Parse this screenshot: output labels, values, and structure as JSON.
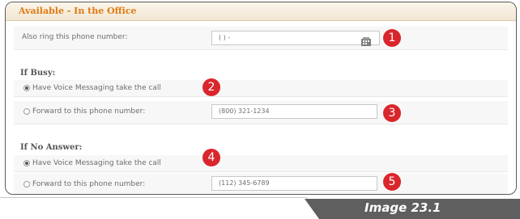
{
  "section": {
    "title": "Available - In the Office"
  },
  "also_ring": {
    "label": "Also ring this phone number:",
    "value": "( )  -"
  },
  "if_busy": {
    "heading": "If Busy:",
    "voice_option": "Have Voice Messaging take the call",
    "forward_option": "Forward to this phone number:",
    "forward_value": "(800) 321-1234",
    "selected": "voice"
  },
  "if_no_answer": {
    "heading": "If No Answer:",
    "voice_option": "Have Voice Messaging take the call",
    "forward_option": "Forward to this phone number:",
    "forward_value": "(112) 345-6789",
    "selected": "voice"
  },
  "callouts": [
    "1",
    "2",
    "3",
    "4",
    "5"
  ],
  "caption": "Image 23.1",
  "colors": {
    "header_text": "#e07a12",
    "badge": "#d9262c",
    "caption_bar": "#5f5f5f"
  }
}
